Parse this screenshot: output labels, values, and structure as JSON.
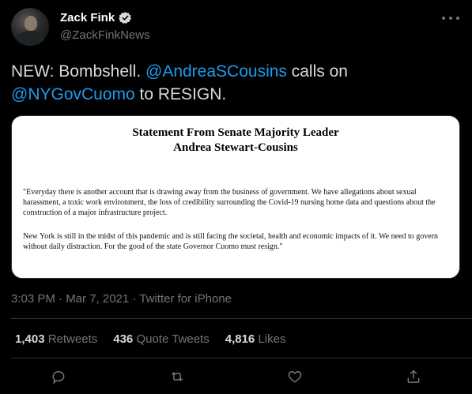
{
  "author": {
    "name": "Zack Fink",
    "handle": "@ZackFinkNews"
  },
  "tweet": {
    "text_1": "NEW: Bombshell. ",
    "mention_1": "@AndreaSCousins",
    "text_2": " calls on ",
    "mention_2": "@NYGovCuomo",
    "text_3": " to RESIGN."
  },
  "statement": {
    "title_line1": "Statement From Senate Majority Leader",
    "title_line2": "Andrea Stewart-Cousins",
    "paragraph1": "\"Everyday there is another account that is drawing away from the business of government. We have allegations about sexual harassment, a toxic work environment, the loss of credibility surrounding the Covid-19 nursing home data and questions about the construction of a major infrastructure project.",
    "paragraph2": "New York is still in the midst of this pandemic and is still facing the societal, health and economic impacts of it. We need to govern without daily distraction. For the good of the state Governor Cuomo must resign.\""
  },
  "meta": "3:03 PM · Mar 7, 2021 · Twitter for iPhone",
  "stats": {
    "retweets_count": "1,403",
    "retweets_label": "Retweets",
    "quotes_count": "436",
    "quotes_label": "Quote Tweets",
    "likes_count": "4,816",
    "likes_label": "Likes"
  },
  "icons": {
    "verified": "verified-badge-icon",
    "more": "more-options-icon",
    "reply": "reply-icon",
    "retweet": "retweet-icon",
    "like": "heart-icon",
    "share": "share-icon"
  },
  "colors": {
    "background": "#000000",
    "link": "#1d9bf0",
    "muted": "#6e767d",
    "text": "#d9d9d9"
  }
}
